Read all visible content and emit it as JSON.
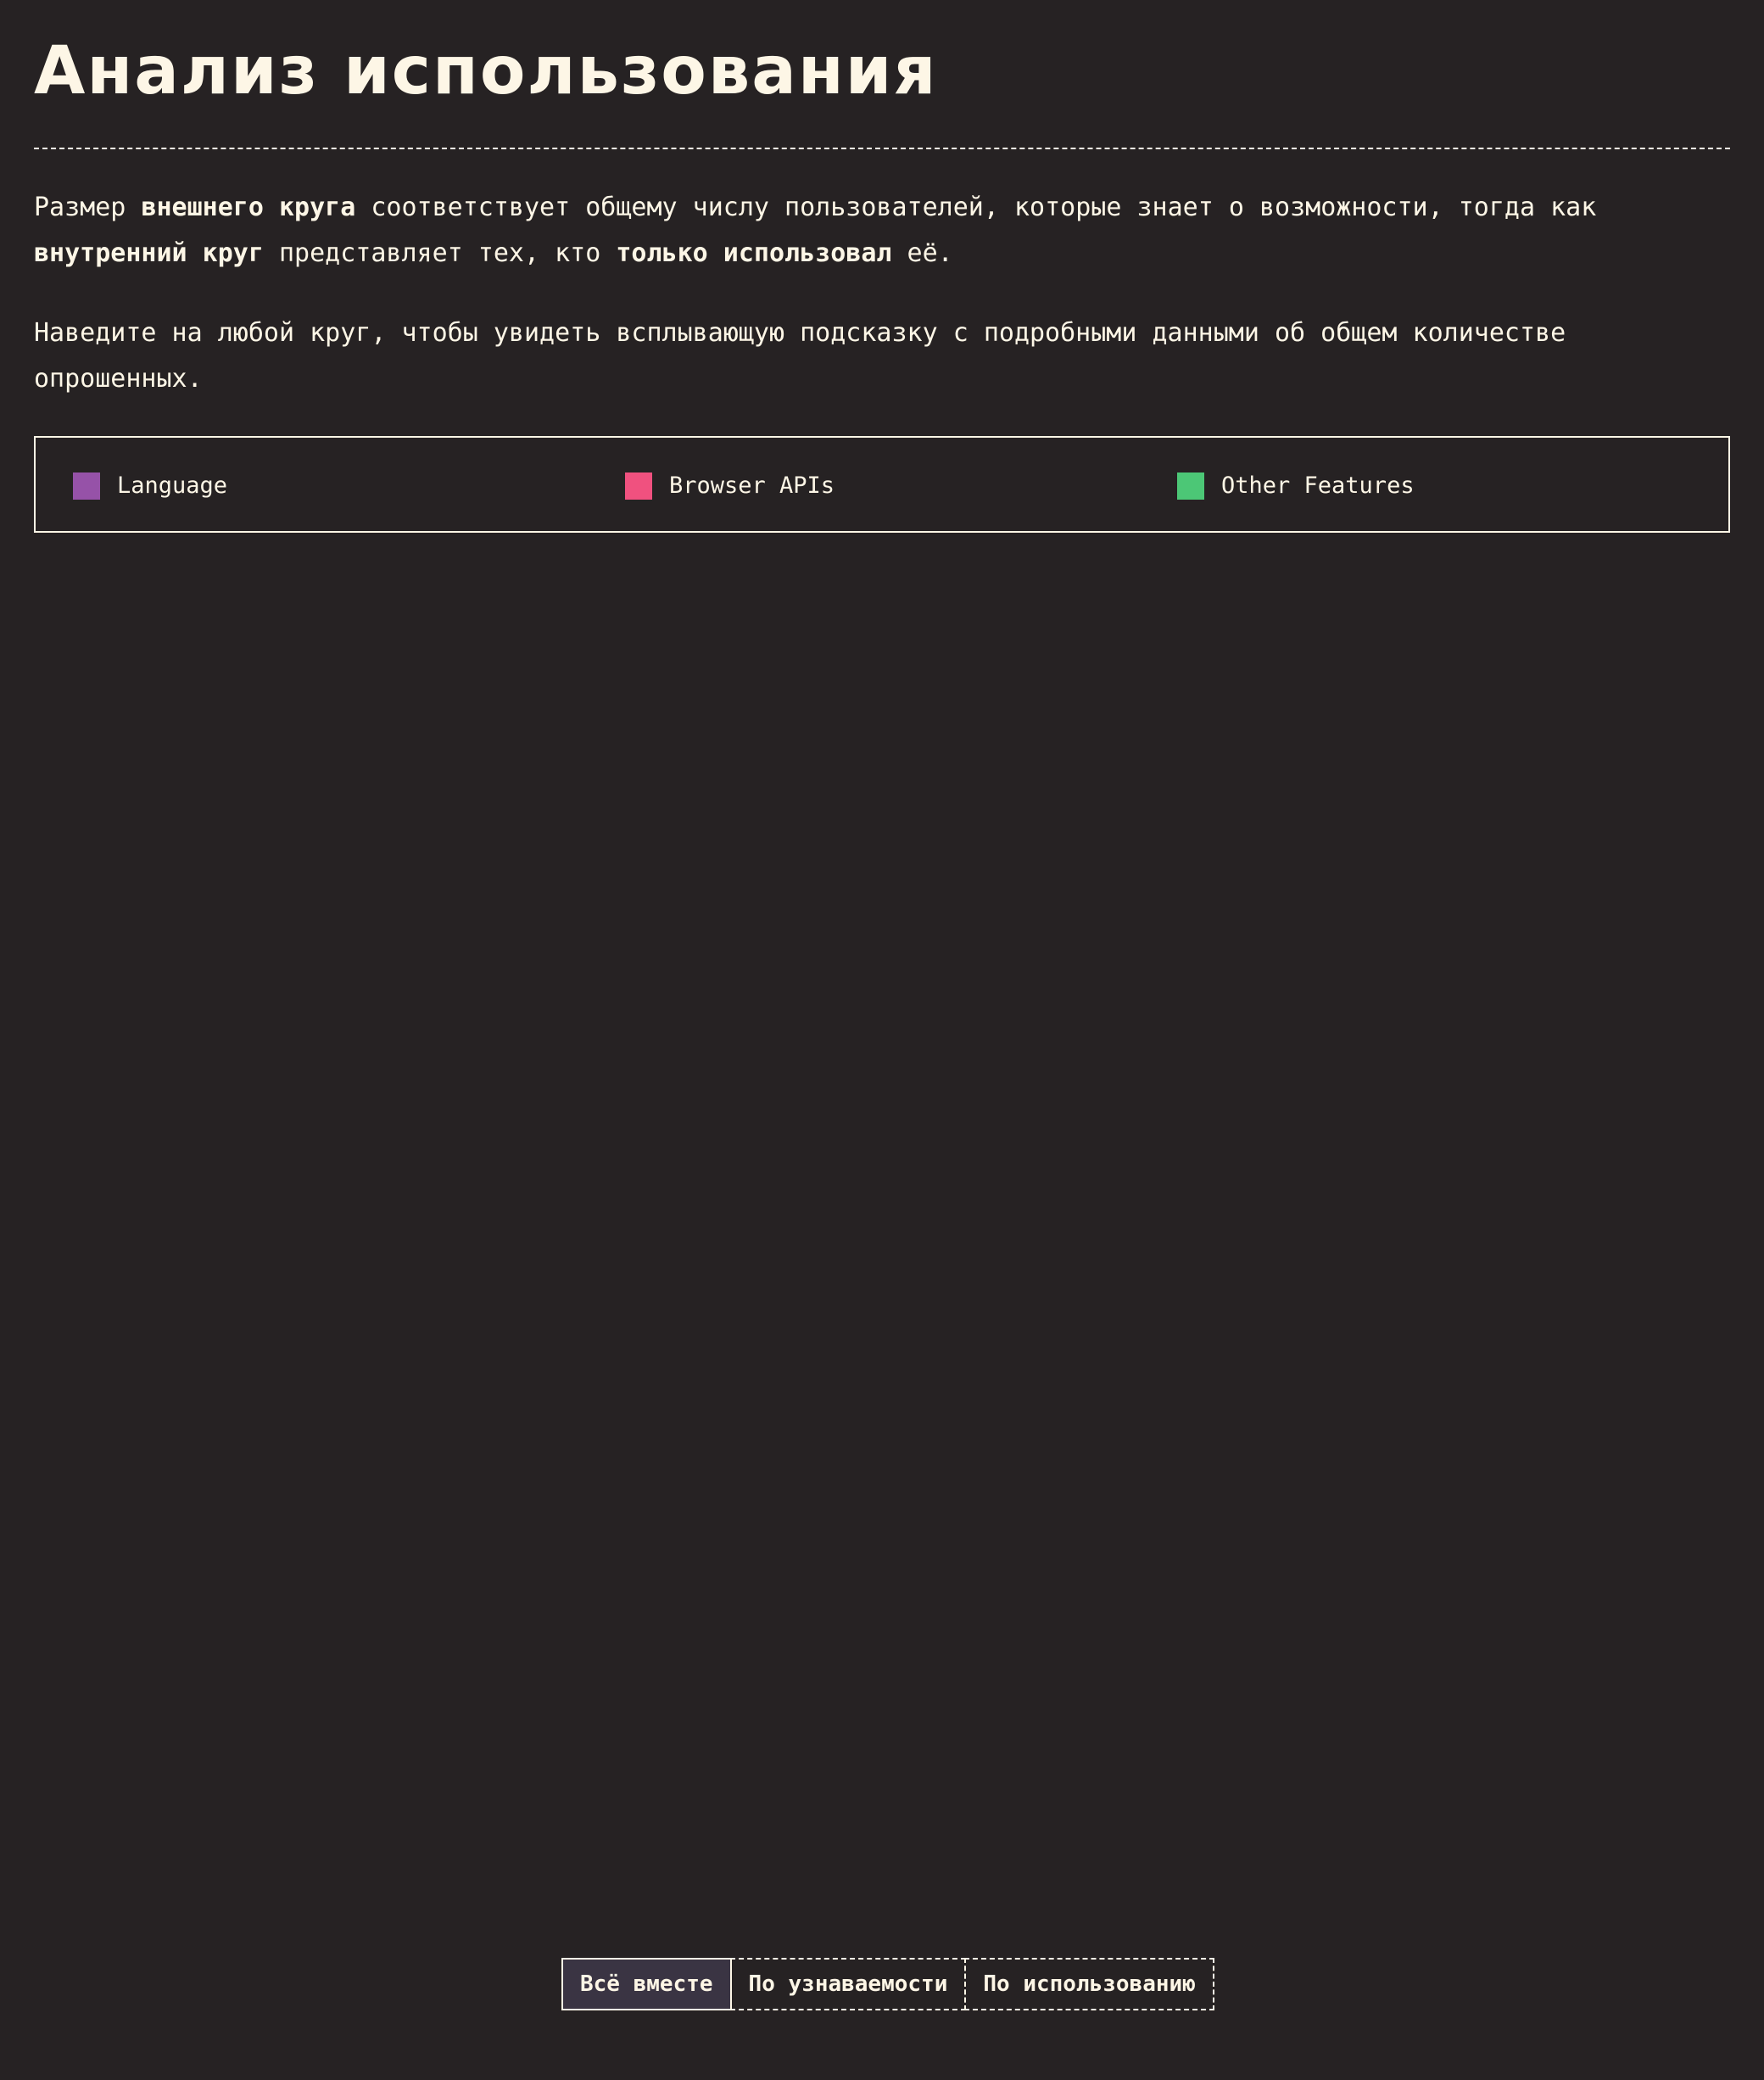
{
  "page": {
    "title": "Анализ использования"
  },
  "intro": {
    "p1_a": "Размер ",
    "p1_b": "внешнего круга",
    "p1_c": " соответствует общему числу пользователей, которые знает о возможности, тогда как ",
    "p1_d": "внутренний круг",
    "p1_e": " представляет тех, кто ",
    "p1_f": "только использовал",
    "p1_g": " её.",
    "p2": "Наведите на любой круг, чтобы увидеть всплывающую подсказку с подробными данными об общем количестве опрошенных."
  },
  "legend": {
    "items": [
      {
        "label": "Language",
        "color": "#9652a8"
      },
      {
        "label": "Browser APIs",
        "color": "#f0517f"
      },
      {
        "label": "Other Features",
        "color": "#4cc776"
      }
    ]
  },
  "view_toggle": {
    "options": [
      {
        "label": "Всё вместе",
        "active": true
      },
      {
        "label": "По узнаваемости",
        "active": false
      },
      {
        "label": "По использованию",
        "active": false
      }
    ]
  }
}
